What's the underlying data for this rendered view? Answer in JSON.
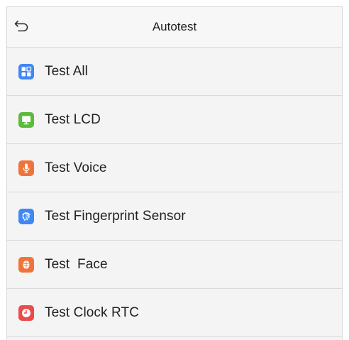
{
  "header": {
    "title": "Autotest",
    "back_icon": "back-arrow-icon"
  },
  "items": [
    {
      "label": "Test All",
      "icon": "grid-icon",
      "color": "#3f87f5"
    },
    {
      "label": "Test LCD",
      "icon": "monitor-icon",
      "color": "#5cba3c"
    },
    {
      "label": "Test Voice",
      "icon": "microphone-icon",
      "color": "#f0743a"
    },
    {
      "label": "Test Fingerprint Sensor",
      "icon": "fingerprint-icon",
      "color": "#3f87f5"
    },
    {
      "label": "Test  Face",
      "icon": "face-icon",
      "color": "#f0743a"
    },
    {
      "label": "Test Clock RTC",
      "icon": "clock-icon",
      "color": "#ea4b4b"
    }
  ]
}
